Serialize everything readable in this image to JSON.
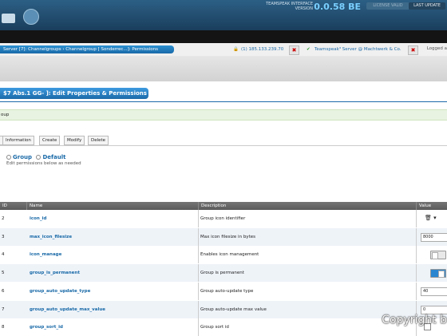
{
  "header": {
    "interface_label_1": "TEAMSPEAK INTERFACE",
    "interface_label_2": "VERSION",
    "version": "0.0.58 BE",
    "license_button": "LICENSE VALID",
    "last_update_button": "LAST UPDATE"
  },
  "nav": {
    "breadcrumb": "Server [7]: Channelgroups  ›  Channelgroup [ Sonderrec...]: Permissions",
    "server_ip": "(1) 185.133.239.70",
    "server_name": "Teamspeak³ Server @ Machtwerk & Co.",
    "logged_as": "Logged a"
  },
  "page": {
    "title": "$7 Abs.1 GG- ]: Edit Properties & Permissions",
    "info_text": "oup",
    "tabs": [
      "Information",
      "Create",
      "Modify",
      "Delete"
    ],
    "group_option_1": "Group",
    "group_option_2": "Default",
    "subtext": "Edit permissions below as needed"
  },
  "table": {
    "headers": {
      "id": "ID",
      "name": "Name",
      "description": "Description",
      "value": "Value"
    },
    "rows": [
      {
        "id": "2",
        "name": "icon_id",
        "description": "Group icon identifier",
        "control": "icon"
      },
      {
        "id": "3",
        "name": "max_icon_filesize",
        "description": "Max icon filesize in bytes",
        "control": "input",
        "value": "8000"
      },
      {
        "id": "4",
        "name": "icon_manage",
        "description": "Enables icon management",
        "control": "toggle-off"
      },
      {
        "id": "5",
        "name": "group_is_permanent",
        "description": "Group is permanent",
        "control": "toggle-on"
      },
      {
        "id": "6",
        "name": "group_auto_update_type",
        "description": "Group auto-update type",
        "control": "input",
        "value": "40"
      },
      {
        "id": "7",
        "name": "group_auto_update_max_value",
        "description": "Group auto-update max value",
        "control": "input",
        "value": "0"
      },
      {
        "id": "8",
        "name": "group_sort_id",
        "description": "Group sort id",
        "control": "checkbox"
      }
    ]
  },
  "watermark": "Copyright b"
}
